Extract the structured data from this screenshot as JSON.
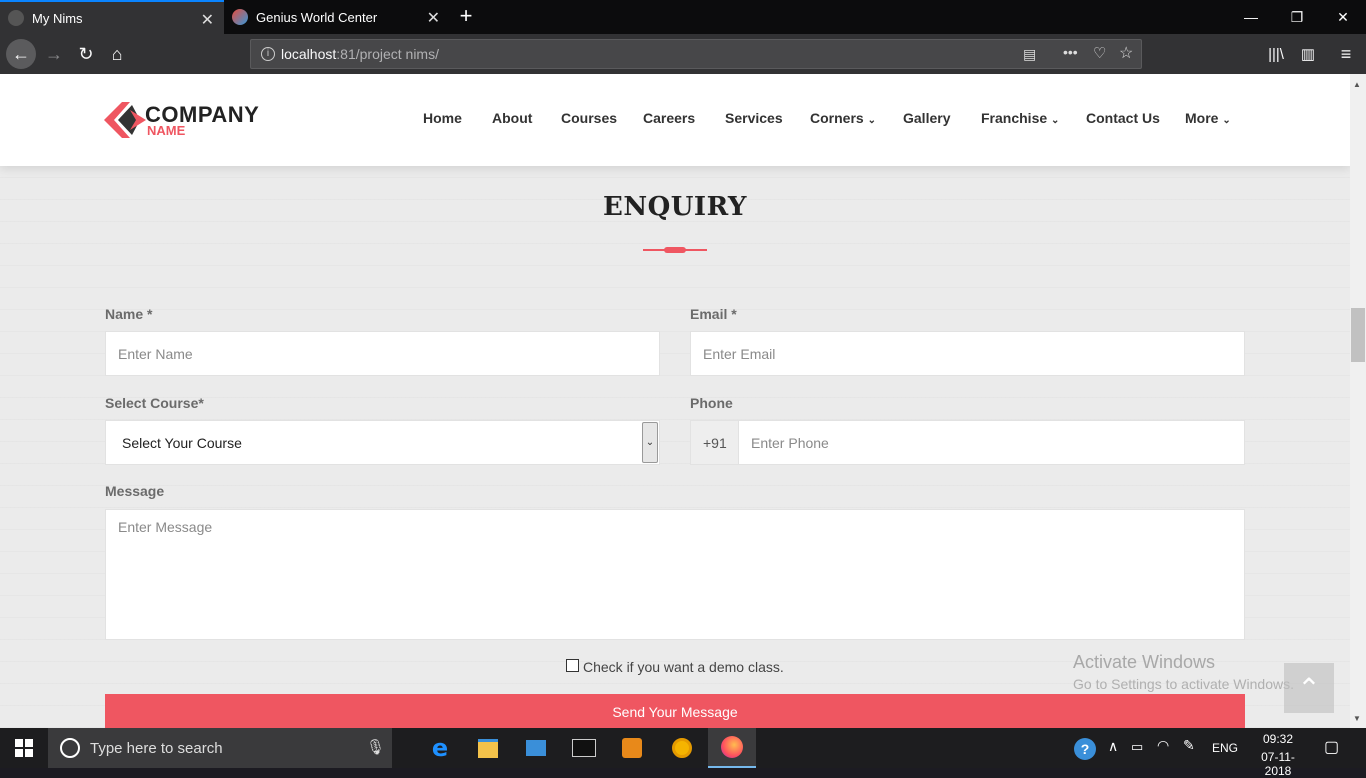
{
  "browser": {
    "tabs": [
      {
        "title": "My Nims"
      },
      {
        "title": "Genius World Center"
      }
    ],
    "url": {
      "host": "localhost",
      "rest": ":81/project nims/"
    }
  },
  "site": {
    "logo": {
      "line1": "COMPANY",
      "line2": "NAME"
    },
    "menu": [
      "Home",
      "About",
      "Courses",
      "Careers",
      "Services",
      "Corners",
      "Gallery",
      "Franchise",
      "Contact Us",
      "More"
    ]
  },
  "enquiry": {
    "title": "ENQUIRY",
    "name_label": "Name *",
    "name_placeholder": "Enter Name",
    "email_label": "Email *",
    "email_placeholder": "Enter Email",
    "course_label": "Select Course*",
    "course_selected": "Select Your Course",
    "phone_label": "Phone",
    "phone_prefix": "+91",
    "phone_placeholder": "Enter Phone",
    "message_label": "Message",
    "message_placeholder": "Enter Message",
    "demo_label": "Check if you want a demo class.",
    "submit_label": "Send Your Message"
  },
  "watermark": {
    "line1": "Activate Windows",
    "line2": "Go to Settings to activate Windows."
  },
  "taskbar": {
    "search_placeholder": "Type here to search",
    "lang": "ENG",
    "time": "09:32",
    "date": "07-11-2018"
  },
  "colors": {
    "accent": "#ef5661",
    "tab_highlight": "#0a84ff"
  }
}
